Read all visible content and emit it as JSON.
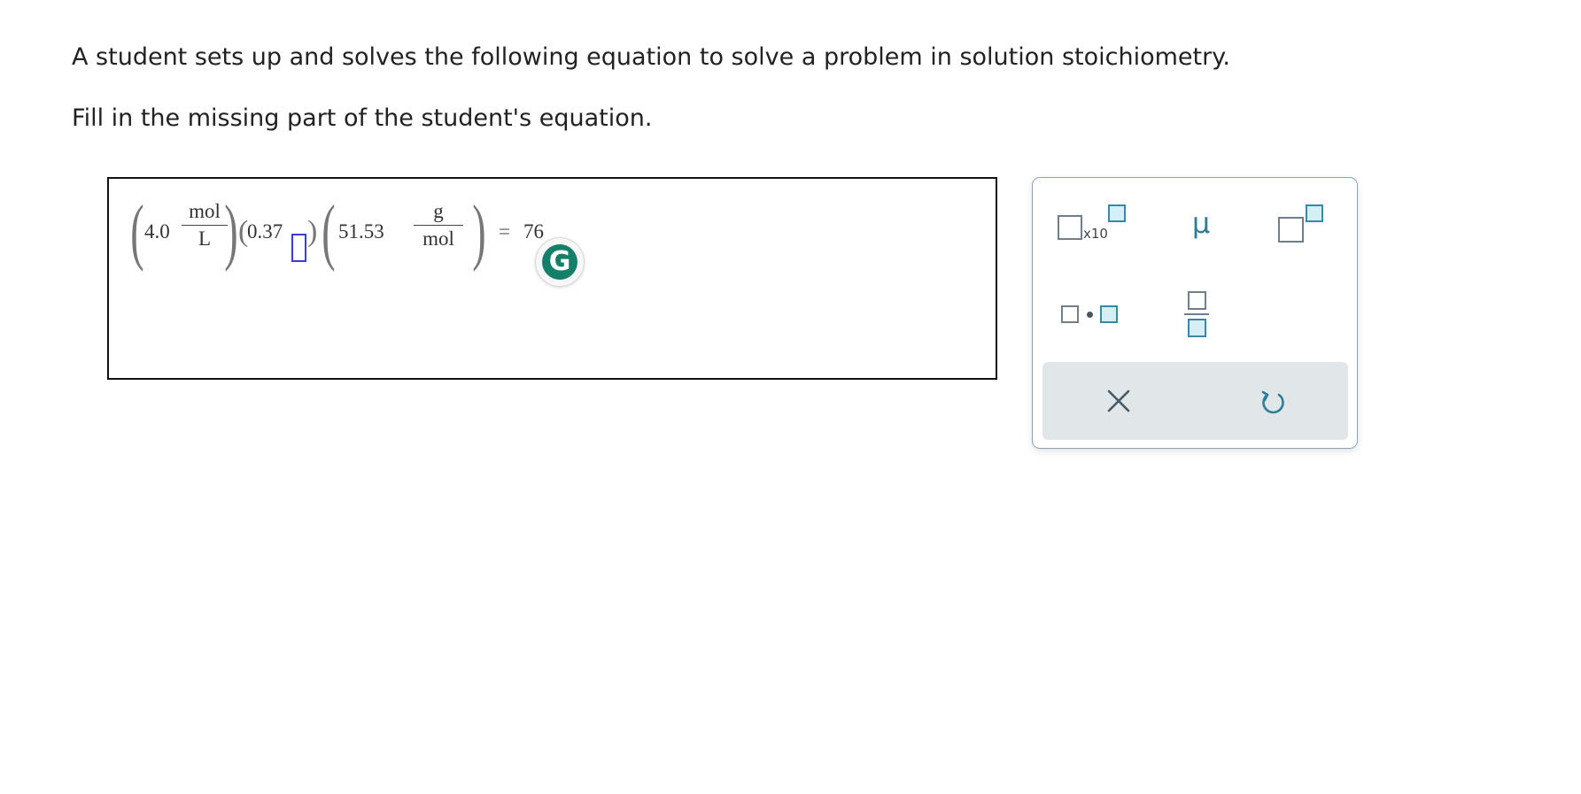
{
  "question": {
    "line1": "A student sets up and solves the following equation to solve a problem in solution stoichiometry.",
    "line2": "Fill in the missing part of the student's equation."
  },
  "equation": {
    "term1_value": "4.0",
    "term1_unit_num": "mol",
    "term1_unit_den": "L",
    "term2_value": "0.37",
    "term3_value": "51.53",
    "term3_unit_num": "g",
    "term3_unit_den": "mol",
    "equals": "=",
    "result": "76"
  },
  "grammarly": {
    "glyph": "G",
    "color": "#15806a"
  },
  "palette": {
    "x10_label": "x10",
    "mu_label": "μ",
    "clear_icon": "close-icon",
    "undo_icon": "undo-icon",
    "accent_color": "#3a88a8"
  }
}
